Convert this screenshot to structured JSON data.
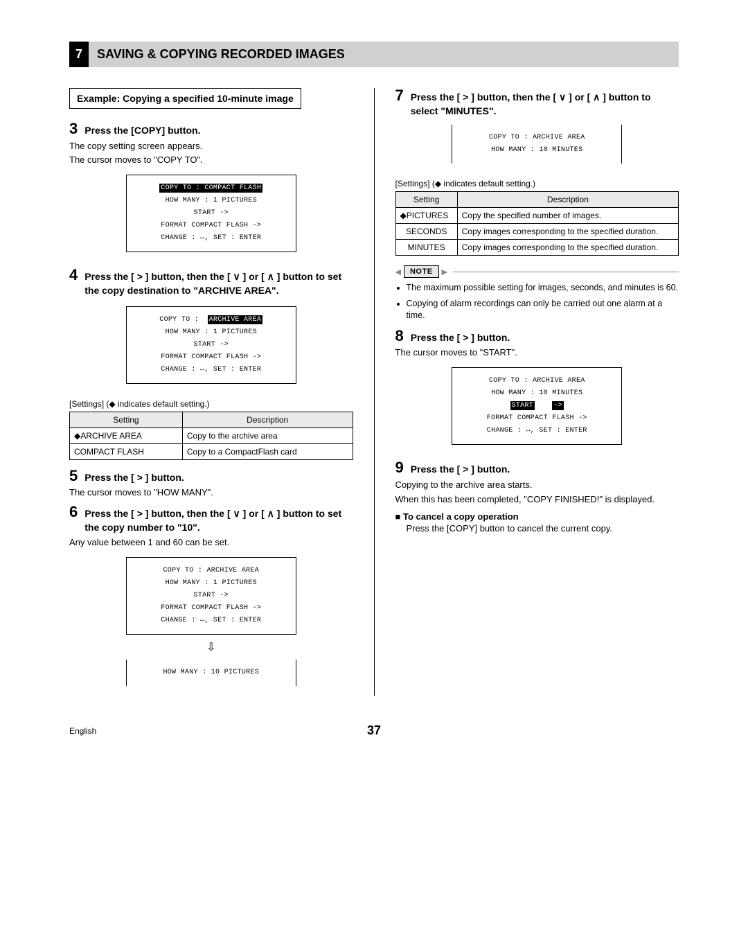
{
  "chapter": {
    "num": "7",
    "title": "SAVING & COPYING RECORDED IMAGES"
  },
  "example_box": "Example: Copying a specified 10-minute image",
  "steps": {
    "s3": "Press the [COPY] button.",
    "s3_body1": "The copy setting screen appears.",
    "s3_body2": "The cursor moves to \"COPY TO\".",
    "s4": "Press the [ > ] button, then the [ ∨ ] or [ ∧ ] button to set the copy destination to \"ARCHIVE AREA\".",
    "s5": "Press the [ > ] button.",
    "s5_body": "The cursor moves to \"HOW MANY\".",
    "s6": "Press the [ > ] button, then the [ ∨ ] or [ ∧ ] button to set the copy number to \"10\".",
    "s6_body": "Any value between 1 and 60 can be set.",
    "s7": "Press the [ > ] button, then the [ ∨ ] or [ ∧ ] button to select \"MINUTES\".",
    "s8": "Press the [ > ] button.",
    "s8_body": "The cursor moves to \"START\".",
    "s9": "Press the [ > ] button.",
    "s9_body1": "Copying to the archive area starts.",
    "s9_body2": "When this has been completed, \"COPY FINISHED!\" is displayed."
  },
  "osd": {
    "copyto_cf": "COPY TO  :  COMPACT FLASH",
    "copyto_ar": "COPY TO  :  ARCHIVE AREA",
    "howmany_1p": "HOW MANY :  1 PICTURES",
    "howmany_10p": "HOW MANY :  10 PICTURES",
    "howmany_10m": "HOW MANY :  10 MINUTES",
    "start": "START    ->",
    "format": "FORMAT COMPACT FLASH ->",
    "change": "CHANGE : ↔,   SET : ENTER",
    "copyto_label": "COPY TO  :",
    "archive_area": "ARCHIVE AREA",
    "start_label": "START",
    "start_arrow": "->"
  },
  "settings_note": "[Settings] (◆ indicates default setting.)",
  "table1": {
    "h1": "Setting",
    "h2": "Description",
    "r1c1": "◆ARCHIVE AREA",
    "r1c2": "Copy to the archive area",
    "r2c1": "COMPACT FLASH",
    "r2c2": "Copy to a CompactFlash card"
  },
  "table2": {
    "h1": "Setting",
    "h2": "Description",
    "r1c1": "◆PICTURES",
    "r1c2": "Copy the specified number of images.",
    "r2c1": "SECONDS",
    "r2c2": "Copy images corresponding to the specified duration.",
    "r3c1": "MINUTES",
    "r3c2": "Copy images corresponding to the specified duration."
  },
  "note": {
    "label": "NOTE",
    "li1": "The maximum possible setting for images, seconds, and minutes is 60.",
    "li2": "Copying of alarm recordings can only be carried out one alarm at a time."
  },
  "cancel": {
    "head": "To cancel a copy operation",
    "body": "Press the [COPY] button to cancel the current copy."
  },
  "footer": {
    "lang": "English",
    "page": "37"
  },
  "arrow": "⇩"
}
